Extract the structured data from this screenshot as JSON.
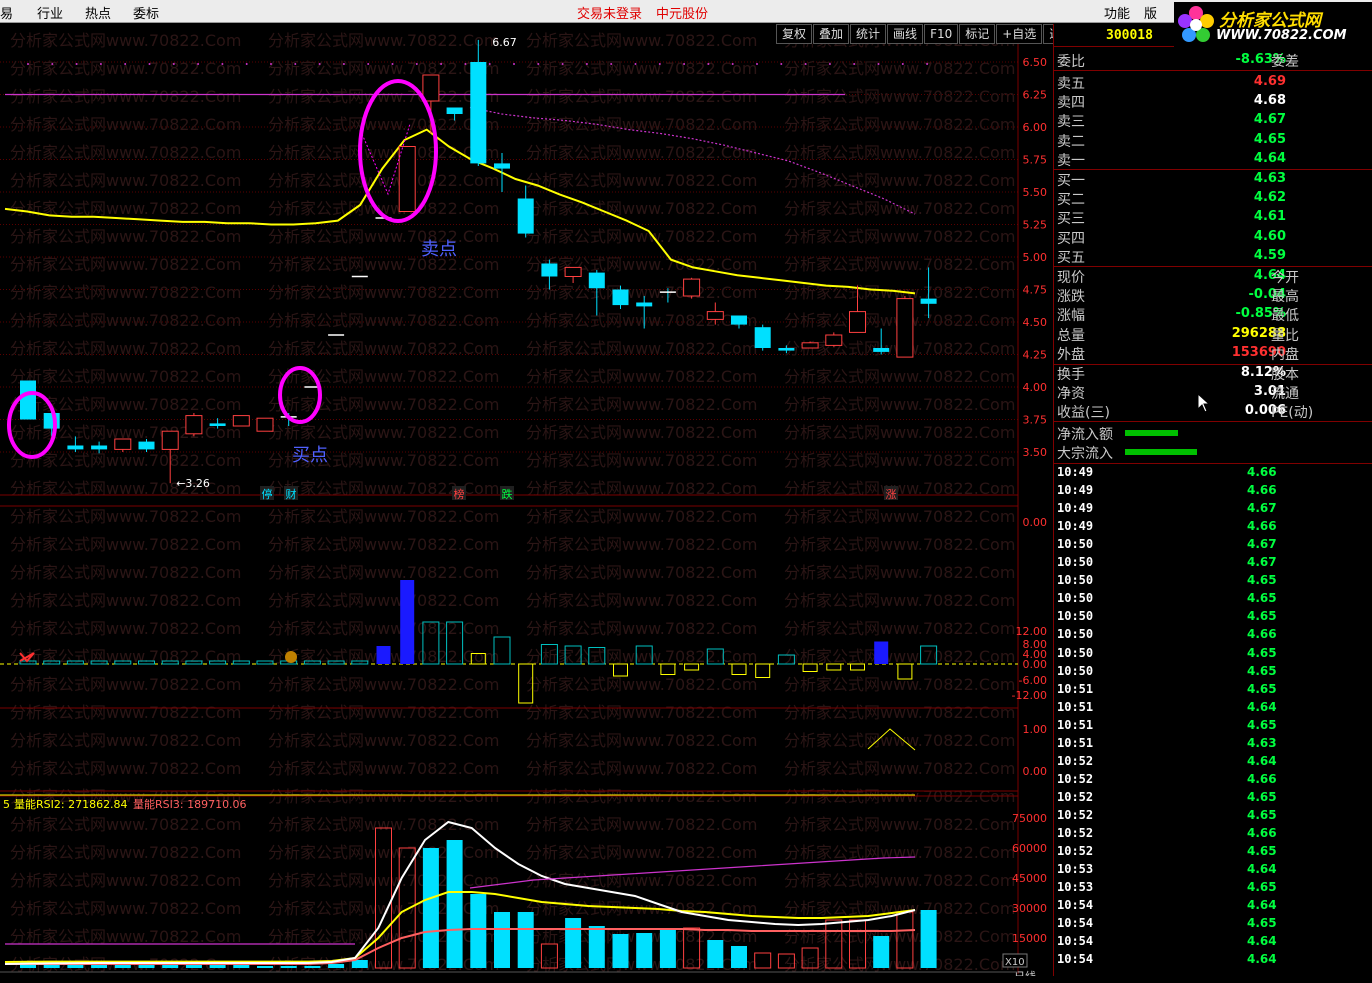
{
  "menubar": {
    "items": [
      "易",
      "行业",
      "热点",
      "委标"
    ],
    "status_login": "交易未登录",
    "broker": "中元股份",
    "right_items": [
      "功能",
      "版"
    ]
  },
  "toolbar": {
    "buttons": [
      "复权",
      "叠加",
      "统计",
      "画线",
      "F10",
      "标记",
      "+自选",
      "返回"
    ]
  },
  "header": {
    "stock_code": "300018"
  },
  "logo": {
    "title": "分析家公式网",
    "url": "WWW.70822.COM"
  },
  "watermark": "分析家公式网www.70822.Com",
  "price_axis": [
    "6.50",
    "6.25",
    "6.00",
    "5.75",
    "5.50",
    "5.25",
    "5.00",
    "4.75",
    "4.50",
    "4.25",
    "4.00",
    "3.75",
    "3.50"
  ],
  "vol_axis": [
    "0.00",
    "12.00",
    "8.00",
    "4.00",
    "0.00",
    "-6.00",
    "-12.00"
  ],
  "ind_axis": [
    "1.00",
    "0.00"
  ],
  "rsi_axis": [
    "75000",
    "60000",
    "45000",
    "30000",
    "15000"
  ],
  "chart_labels": {
    "high_mark": "6.67",
    "low_mark": "3.26",
    "sell_label": "卖点",
    "buy_label": "买点",
    "tags": [
      "停",
      "财",
      "榜",
      "跌",
      "涨"
    ],
    "rsi_legend_prefix": "5",
    "rsi_legend2": "量能RSI2: 271862.84",
    "rsi_legend3": "量能RSI3: 189710.06",
    "bottom_x10": "X10",
    "bottom_period": "日线"
  },
  "order_book": {
    "weibi_label": "委比",
    "weibi_value": "-8.63%",
    "weicha_label": "委差",
    "sells": [
      {
        "label": "卖五",
        "price": "4.69",
        "color": "red"
      },
      {
        "label": "卖四",
        "price": "4.68",
        "color": "white"
      },
      {
        "label": "卖三",
        "price": "4.67",
        "color": "green"
      },
      {
        "label": "卖二",
        "price": "4.65",
        "color": "green"
      },
      {
        "label": "卖一",
        "price": "4.64",
        "color": "green"
      }
    ],
    "buys": [
      {
        "label": "买一",
        "price": "4.63",
        "color": "green"
      },
      {
        "label": "买二",
        "price": "4.62",
        "color": "green"
      },
      {
        "label": "买三",
        "price": "4.61",
        "color": "green"
      },
      {
        "label": "买四",
        "price": "4.60",
        "color": "green"
      },
      {
        "label": "买五",
        "price": "4.59",
        "color": "green"
      }
    ]
  },
  "quote": [
    {
      "label": "现价",
      "value": "4.64",
      "color": "green",
      "label2": "今开"
    },
    {
      "label": "涨跌",
      "value": "-0.04",
      "color": "green",
      "label2": "最高"
    },
    {
      "label": "涨幅",
      "value": "-0.85%",
      "color": "green",
      "label2": "最低"
    },
    {
      "label": "总量",
      "value": "296288",
      "color": "yellow",
      "label2": "量比"
    },
    {
      "label": "外盘",
      "value": "153690",
      "color": "red",
      "label2": "内盘"
    }
  ],
  "fundamentals": [
    {
      "label": "换手",
      "value": "8.12%",
      "label2": "股本"
    },
    {
      "label": "净资",
      "value": "3.01",
      "label2": "流通"
    },
    {
      "label": "收益(三)",
      "value": "0.006",
      "label2": "PE(动)"
    }
  ],
  "flows": [
    {
      "label": "净流入额",
      "fill": 0.55
    },
    {
      "label": "大宗流入",
      "fill": 0.75
    }
  ],
  "ticks": [
    {
      "time": "10:49",
      "price": "4.66"
    },
    {
      "time": "10:49",
      "price": "4.66"
    },
    {
      "time": "10:49",
      "price": "4.67"
    },
    {
      "time": "10:49",
      "price": "4.66"
    },
    {
      "time": "10:50",
      "price": "4.67"
    },
    {
      "time": "10:50",
      "price": "4.67"
    },
    {
      "time": "10:50",
      "price": "4.65"
    },
    {
      "time": "10:50",
      "price": "4.65"
    },
    {
      "time": "10:50",
      "price": "4.65"
    },
    {
      "time": "10:50",
      "price": "4.66"
    },
    {
      "time": "10:50",
      "price": "4.65"
    },
    {
      "time": "10:50",
      "price": "4.65"
    },
    {
      "time": "10:51",
      "price": "4.65"
    },
    {
      "time": "10:51",
      "price": "4.64"
    },
    {
      "time": "10:51",
      "price": "4.65"
    },
    {
      "time": "10:51",
      "price": "4.63"
    },
    {
      "time": "10:52",
      "price": "4.64"
    },
    {
      "time": "10:52",
      "price": "4.66"
    },
    {
      "time": "10:52",
      "price": "4.65"
    },
    {
      "time": "10:52",
      "price": "4.65"
    },
    {
      "time": "10:52",
      "price": "4.66"
    },
    {
      "time": "10:52",
      "price": "4.65"
    },
    {
      "time": "10:53",
      "price": "4.64"
    },
    {
      "time": "10:53",
      "price": "4.65"
    },
    {
      "time": "10:54",
      "price": "4.64"
    },
    {
      "time": "10:54",
      "price": "4.65"
    },
    {
      "time": "10:54",
      "price": "4.64"
    },
    {
      "time": "10:54",
      "price": "4.64"
    }
  ],
  "chart_data": {
    "type": "candlestick",
    "y_range": [
      3.3,
      6.75
    ],
    "candles": [
      {
        "o": 4.05,
        "h": 4.05,
        "l": 3.75,
        "c": 3.75,
        "up": false
      },
      {
        "o": 3.8,
        "h": 3.82,
        "l": 3.62,
        "c": 3.68,
        "up": false
      },
      {
        "o": 3.55,
        "h": 3.62,
        "l": 3.5,
        "c": 3.52,
        "up": false
      },
      {
        "o": 3.52,
        "h": 3.58,
        "l": 3.49,
        "c": 3.55,
        "up": false
      },
      {
        "o": 3.52,
        "h": 3.6,
        "l": 3.5,
        "c": 3.6,
        "up": true
      },
      {
        "o": 3.58,
        "h": 3.6,
        "l": 3.5,
        "c": 3.52,
        "up": false
      },
      {
        "o": 3.52,
        "h": 3.66,
        "l": 3.26,
        "c": 3.66,
        "up": true
      },
      {
        "o": 3.64,
        "h": 3.8,
        "l": 3.62,
        "c": 3.78,
        "up": true
      },
      {
        "o": 3.72,
        "h": 3.76,
        "l": 3.68,
        "c": 3.7,
        "up": false
      },
      {
        "o": 3.7,
        "h": 3.78,
        "l": 3.7,
        "c": 3.78,
        "up": true
      },
      {
        "o": 3.66,
        "h": 3.76,
        "l": 3.66,
        "c": 3.76,
        "up": true
      },
      {
        "o": 3.77,
        "h": 3.8,
        "l": 3.7,
        "c": 3.77,
        "up": false
      },
      {
        "o": 4.0,
        "h": 4.0,
        "l": 4.0,
        "c": 4.0,
        "up": true
      },
      {
        "o": 4.4,
        "h": 4.4,
        "l": 4.4,
        "c": 4.4,
        "up": true
      },
      {
        "o": 4.85,
        "h": 4.85,
        "l": 4.85,
        "c": 4.85,
        "up": true
      },
      {
        "o": 5.3,
        "h": 5.3,
        "l": 5.3,
        "c": 5.3,
        "up": true
      },
      {
        "o": 5.35,
        "h": 5.85,
        "l": 5.35,
        "c": 5.85,
        "up": true
      },
      {
        "o": 6.2,
        "h": 6.4,
        "l": 5.95,
        "c": 6.4,
        "up": true
      },
      {
        "o": 6.15,
        "h": 6.15,
        "l": 6.05,
        "c": 6.1,
        "up": false
      },
      {
        "o": 6.5,
        "h": 6.67,
        "l": 5.7,
        "c": 5.72,
        "up": false
      },
      {
        "o": 5.72,
        "h": 5.8,
        "l": 5.5,
        "c": 5.68,
        "up": false
      },
      {
        "o": 5.45,
        "h": 5.55,
        "l": 5.15,
        "c": 5.18,
        "up": false
      },
      {
        "o": 4.95,
        "h": 4.98,
        "l": 4.75,
        "c": 4.85,
        "up": false
      },
      {
        "o": 4.85,
        "h": 4.92,
        "l": 4.8,
        "c": 4.92,
        "up": true
      },
      {
        "o": 4.88,
        "h": 4.9,
        "l": 4.55,
        "c": 4.76,
        "up": false
      },
      {
        "o": 4.75,
        "h": 4.78,
        "l": 4.6,
        "c": 4.63,
        "up": false
      },
      {
        "o": 4.65,
        "h": 4.7,
        "l": 4.45,
        "c": 4.62,
        "up": false
      },
      {
        "o": 4.73,
        "h": 4.76,
        "l": 4.65,
        "c": 4.72,
        "up": false
      },
      {
        "o": 4.7,
        "h": 4.84,
        "l": 4.68,
        "c": 4.83,
        "up": true
      },
      {
        "o": 4.52,
        "h": 4.65,
        "l": 4.48,
        "c": 4.58,
        "up": true
      },
      {
        "o": 4.55,
        "h": 4.55,
        "l": 4.45,
        "c": 4.48,
        "up": false
      },
      {
        "o": 4.46,
        "h": 4.48,
        "l": 4.28,
        "c": 4.3,
        "up": false
      },
      {
        "o": 4.3,
        "h": 4.32,
        "l": 4.26,
        "c": 4.28,
        "up": false
      },
      {
        "o": 4.3,
        "h": 4.35,
        "l": 4.3,
        "c": 4.34,
        "up": true
      },
      {
        "o": 4.32,
        "h": 4.42,
        "l": 4.31,
        "c": 4.4,
        "up": true
      },
      {
        "o": 4.42,
        "h": 4.78,
        "l": 4.42,
        "c": 4.58,
        "up": true
      },
      {
        "o": 4.3,
        "h": 4.45,
        "l": 4.25,
        "c": 4.27,
        "up": false
      },
      {
        "o": 4.23,
        "h": 4.7,
        "l": 4.23,
        "c": 4.68,
        "up": true
      },
      {
        "o": 4.68,
        "h": 4.92,
        "l": 4.53,
        "c": 4.64,
        "up": false
      }
    ],
    "ma_yellow": [
      5.37,
      5.35,
      5.32,
      5.31,
      5.31,
      5.3,
      5.29,
      5.28,
      5.27,
      5.27,
      5.26,
      5.26,
      5.25,
      5.25,
      5.26,
      5.28,
      5.4,
      5.68,
      5.9,
      5.98,
      5.85,
      5.75,
      5.68,
      5.6,
      5.55,
      5.48,
      5.42,
      5.35,
      5.28,
      5.2,
      4.98,
      4.92,
      4.89,
      4.86,
      4.84,
      4.82,
      4.8,
      4.78,
      4.77,
      4.75,
      4.74,
      4.72
    ],
    "ma_magenta_flat": 6.25,
    "ma_magenta_tail": [
      6.15,
      6.1,
      6.07,
      6.05,
      6.02,
      5.98,
      5.95,
      5.91,
      5.86,
      5.8,
      5.74,
      5.65,
      5.55,
      5.45,
      5.33
    ],
    "volume_bars": [
      {
        "v": 1.0,
        "t": "c"
      },
      {
        "v": 1.0,
        "t": "c"
      },
      {
        "v": 1.0,
        "t": "c"
      },
      {
        "v": 1.0,
        "t": "c"
      },
      {
        "v": 1.0,
        "t": "c"
      },
      {
        "v": 1.0,
        "t": "c"
      },
      {
        "v": 1.0,
        "t": "c"
      },
      {
        "v": 1.0,
        "t": "c"
      },
      {
        "v": 1.0,
        "t": "c"
      },
      {
        "v": 1.0,
        "t": "c"
      },
      {
        "v": 1.0,
        "t": "c"
      },
      {
        "v": 1.0,
        "t": "c"
      },
      {
        "v": 1.0,
        "t": "c"
      },
      {
        "v": 1.0,
        "t": "c"
      },
      {
        "v": 1.0,
        "t": "c"
      },
      {
        "v": 6.0,
        "t": "b"
      },
      {
        "v": 28.0,
        "t": "b"
      },
      {
        "v": 14.0,
        "t": "c"
      },
      {
        "v": 14.0,
        "t": "c"
      },
      {
        "v": 3.5,
        "t": "y"
      },
      {
        "v": 9.0,
        "t": "c"
      },
      {
        "v": -13.0,
        "t": "y"
      },
      {
        "v": 6.5,
        "t": "c"
      },
      {
        "v": 6.0,
        "t": "c"
      },
      {
        "v": 5.5,
        "t": "c"
      },
      {
        "v": -4.0,
        "t": "y"
      },
      {
        "v": 6.0,
        "t": "c"
      },
      {
        "v": -3.5,
        "t": "y"
      },
      {
        "v": -2.0,
        "t": "y"
      },
      {
        "v": 5.0,
        "t": "c"
      },
      {
        "v": -3.5,
        "t": "y"
      },
      {
        "v": -4.5,
        "t": "y"
      },
      {
        "v": 3.0,
        "t": "c"
      },
      {
        "v": -2.5,
        "t": "y"
      },
      {
        "v": -2.0,
        "t": "y"
      },
      {
        "v": -2.0,
        "t": "y"
      },
      {
        "v": 7.5,
        "t": "b"
      },
      {
        "v": -5.0,
        "t": "y"
      },
      {
        "v": 6.0,
        "t": "c"
      }
    ],
    "rsi_bars": [
      {
        "v": 3000,
        "f": true
      },
      {
        "v": 3500,
        "f": true
      },
      {
        "v": 3000,
        "f": true
      },
      {
        "v": 2000,
        "f": true
      },
      {
        "v": 2000,
        "f": true
      },
      {
        "v": 2500,
        "f": true
      },
      {
        "v": 3000,
        "f": true
      },
      {
        "v": 2000,
        "f": true
      },
      {
        "v": 2000,
        "f": true
      },
      {
        "v": 1500,
        "f": true
      },
      {
        "v": 1000,
        "f": true
      },
      {
        "v": 1000,
        "f": true
      },
      {
        "v": 1000,
        "f": true
      },
      {
        "v": 2000,
        "f": true
      },
      {
        "v": 4000,
        "f": true
      },
      {
        "v": 70000,
        "f": false
      },
      {
        "v": 60000,
        "f": false
      },
      {
        "v": 60000,
        "f": true
      },
      {
        "v": 64000,
        "f": true
      },
      {
        "v": 37000,
        "f": true
      },
      {
        "v": 28000,
        "f": true
      },
      {
        "v": 28000,
        "f": true
      },
      {
        "v": 12000,
        "f": false
      },
      {
        "v": 25000,
        "f": true
      },
      {
        "v": 21000,
        "f": true
      },
      {
        "v": 17000,
        "f": true
      },
      {
        "v": 17500,
        "f": true
      },
      {
        "v": 19000,
        "f": true
      },
      {
        "v": 20000,
        "f": false
      },
      {
        "v": 14000,
        "f": true
      },
      {
        "v": 11000,
        "f": true
      },
      {
        "v": 7500,
        "f": false
      },
      {
        "v": 7000,
        "f": false
      },
      {
        "v": 10000,
        "f": false
      },
      {
        "v": 24000,
        "f": false
      },
      {
        "v": 24000,
        "f": false
      },
      {
        "v": 16000,
        "f": true
      },
      {
        "v": 28000,
        "f": false
      },
      {
        "v": 29000,
        "f": true
      }
    ],
    "rsi_white": [
      2000,
      2200,
      2300,
      2400,
      2500,
      2500,
      2500,
      2500,
      2500,
      2500,
      2500,
      2500,
      2500,
      2500,
      3000,
      5000,
      20000,
      45000,
      64000,
      73000,
      70000,
      60000,
      52000,
      46000,
      42000,
      40000,
      38000,
      36000,
      32000,
      28000,
      26000,
      24000,
      23000,
      22000,
      21500,
      22000,
      23000,
      24000,
      26000,
      29000
    ],
    "rsi_yellow": [
      3000,
      3100,
      3200,
      3200,
      3200,
      3200,
      3200,
      3200,
      3200,
      3200,
      3200,
      3200,
      3200,
      3200,
      3500,
      5000,
      15000,
      28000,
      34000,
      38000,
      38000,
      37000,
      35000,
      33000,
      32000,
      31000,
      30500,
      30000,
      29500,
      28500,
      28000,
      27000,
      26000,
      25500,
      25000,
      25000,
      25500,
      26000,
      27500,
      29000
    ],
    "rsi_salmon": [
      2000,
      2000,
      2000,
      2000,
      2000,
      2000,
      2000,
      2000,
      2000,
      2000,
      2000,
      2000,
      2000,
      2000,
      2500,
      4000,
      10000,
      15000,
      18000,
      19000,
      19500,
      19500,
      19500,
      19500,
      19500,
      19500,
      19500,
      19500,
      19500,
      19500,
      19000,
      19000,
      18500,
      18500,
      18500,
      18500,
      18500,
      18500,
      18500,
      19000
    ],
    "rsi_magenta_flat": 12000,
    "rsi_magenta_tail": [
      40000,
      42000,
      44000,
      45000,
      46000,
      47000,
      48000,
      49000,
      50000,
      51000,
      52000,
      53000,
      54000,
      55000,
      55500
    ]
  }
}
